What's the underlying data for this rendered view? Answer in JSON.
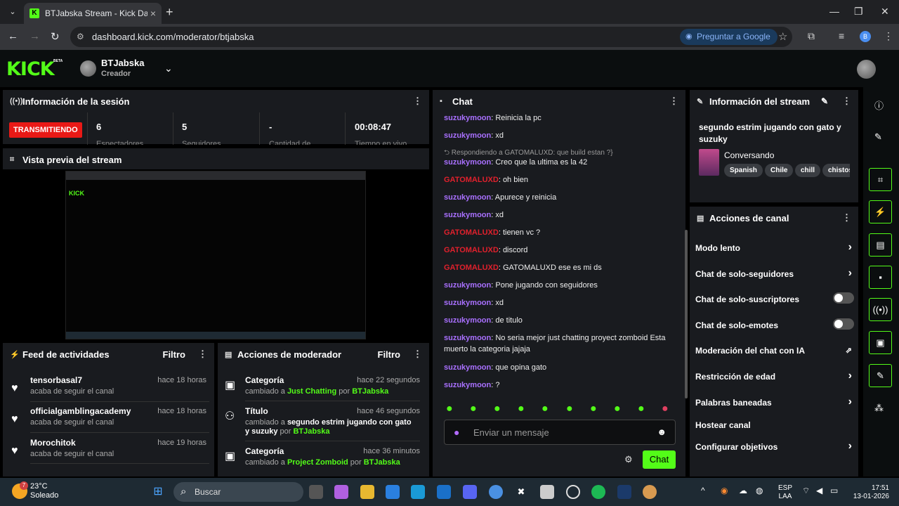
{
  "browser": {
    "tab_title": "BTJabska Stream - Kick Dashboard",
    "url": "dashboard.kick.com/moderator/btjabska",
    "google_button": "Preguntar a Google",
    "profile_initial": "B"
  },
  "header": {
    "logo": "KICK",
    "beta": "BETA",
    "username": "BTJabska",
    "role": "Creador"
  },
  "session": {
    "title": "Información de la sesión",
    "status": "TRANSMITIENDO",
    "stats": [
      {
        "value": "6",
        "label": "Espectadores"
      },
      {
        "value": "5",
        "label": "Seguidores"
      },
      {
        "value": "-",
        "label": "Cantidad de"
      },
      {
        "value": "00:08:47",
        "label": "Tiempo en vivo"
      }
    ]
  },
  "preview": {
    "title": "Vista previa del stream"
  },
  "activity": {
    "title": "Feed de actividades",
    "filter": "Filtro",
    "items": [
      {
        "name": "tensorbasal7",
        "desc": "acaba de seguir el canal",
        "time": "hace 18 horas"
      },
      {
        "name": "officialgamblingacademy",
        "desc": "acaba de seguir el canal",
        "time": "hace 18 horas"
      },
      {
        "name": "Morochitok",
        "desc": "acaba de seguir el canal",
        "time": "hace 19 horas"
      }
    ]
  },
  "mod_actions": {
    "title": "Acciones de moderador",
    "filter": "Filtro",
    "items": [
      {
        "name": "Categoría",
        "time": "hace 22 segundos",
        "pre": "cambiado a ",
        "value": "Just Chatting",
        "mid": " por ",
        "by": "BTJabska"
      },
      {
        "name": "Título",
        "time": "hace 46 segundos",
        "pre": "cambiado a ",
        "value": "segundo estrim jugando con gato y suzuky",
        "mid": " por ",
        "by": "BTJabska"
      },
      {
        "name": "Categoría",
        "time": "hace 36 minutos",
        "pre": "cambiado a ",
        "value": "Project Zomboid",
        "mid": " por ",
        "by": "BTJabska"
      }
    ]
  },
  "chat": {
    "title": "Chat",
    "reply_note": "Respondiendo a GATOMALUXD: que build estan ?}",
    "messages": [
      {
        "user": "suzukymoon",
        "text": "Reinicia la pc",
        "color": "purple"
      },
      {
        "user": "suzukymoon",
        "text": "xd",
        "color": "purple"
      },
      {
        "user": "suzukymoon",
        "text": "Creo que la ultima es la 42",
        "color": "purple"
      },
      {
        "user": "GATOMALUXD",
        "text": "oh bien",
        "color": "red"
      },
      {
        "user": "suzukymoon",
        "text": "Apurece y reinicia",
        "color": "purple"
      },
      {
        "user": "suzukymoon",
        "text": "xd",
        "color": "purple"
      },
      {
        "user": "GATOMALUXD",
        "text": "tienen vc ?",
        "color": "red"
      },
      {
        "user": "GATOMALUXD",
        "text": "discord",
        "color": "red"
      },
      {
        "user": "GATOMALUXD",
        "text": "GATOMALUXD ese es mi ds",
        "color": "red"
      },
      {
        "user": "suzukymoon",
        "text": "Pone jugando con seguidores",
        "color": "purple"
      },
      {
        "user": "suzukymoon",
        "text": "xd",
        "color": "purple"
      },
      {
        "user": "suzukymoon",
        "text": "de titulo",
        "color": "purple"
      },
      {
        "user": "suzukymoon",
        "text": "No seria mejor just chatting proyect zomboid Esta muerto la categoria jajaja",
        "color": "purple"
      },
      {
        "user": "suzukymoon",
        "text": "que opina gato",
        "color": "purple"
      },
      {
        "user": "suzukymoon",
        "text": "?",
        "color": "purple"
      }
    ],
    "input_placeholder": "Enviar un mensaje",
    "send_label": "Chat"
  },
  "stream_info": {
    "title": "Información del stream",
    "stream_title": "segundo estrim jugando con gato y suzuky",
    "category": "Conversando",
    "tags": [
      "Spanish",
      "Chile",
      "chill",
      "chistos"
    ]
  },
  "channel_actions": {
    "title": "Acciones de canal",
    "items": [
      {
        "label": "Modo lento",
        "control": "arrow"
      },
      {
        "label": "Chat de solo-seguidores",
        "control": "arrow"
      },
      {
        "label": "Chat de solo-suscriptores",
        "control": "toggle"
      },
      {
        "label": "Chat de solo-emotes",
        "control": "toggle"
      },
      {
        "label": "Moderación del chat con IA",
        "control": "external"
      },
      {
        "label": "Restricción de edad",
        "control": "arrow"
      },
      {
        "label": "Palabras baneadas",
        "control": "arrow"
      },
      {
        "label": "Hostear canal",
        "control": "none"
      },
      {
        "label": "Configurar objetivos",
        "control": "arrow"
      }
    ]
  },
  "taskbar": {
    "temp": "23°C",
    "weather": "Soleado",
    "weather_badge": "7",
    "search": "Buscar",
    "lang1": "ESP",
    "lang2": "LAA",
    "time": "17:51",
    "date": "13-01-2026"
  },
  "colors": {
    "accent": "#53fc18",
    "live": "#e91916",
    "purple_user": "#a970ff",
    "red_user": "#e0202c"
  }
}
